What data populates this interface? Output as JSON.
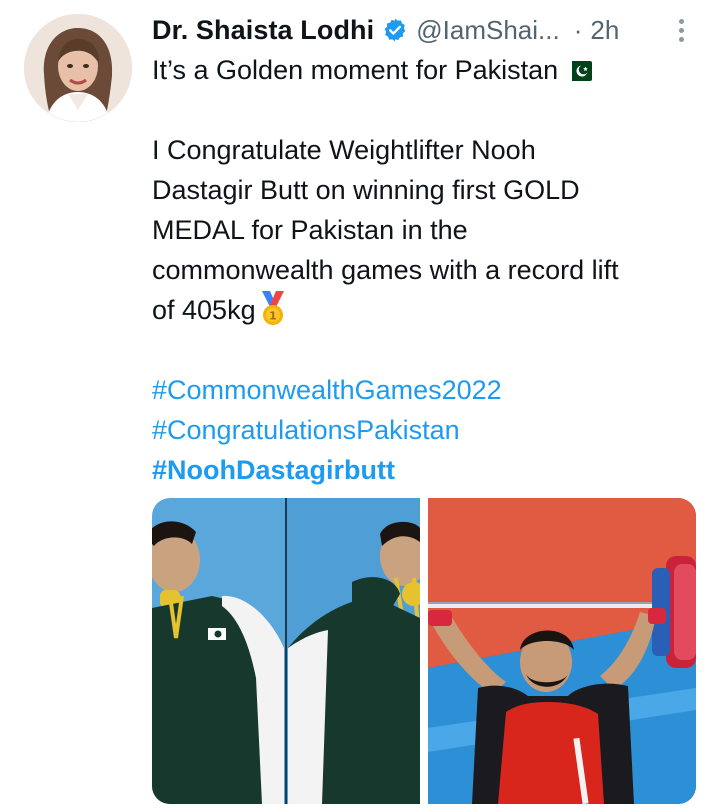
{
  "tweet": {
    "display_name": "Dr. Shaista Lodhi",
    "handle": "@IamShai...",
    "separator": "·",
    "time": "2h",
    "lines": [
      "It’s a Golden moment for Pakistan",
      "I Congratulate Weightlifter Nooh",
      "Dastagir Butt on winning first GOLD",
      "MEDAL for Pakistan in the",
      "commonwealth games with a record lift",
      "of 405kg"
    ],
    "hashtags": [
      "#CommonwealthGames2022",
      "#CongratulationsPakistan",
      "#NoohDastagirbutt"
    ],
    "icons": {
      "verified": "verified-badge-icon",
      "more": "more-options-icon",
      "flag": "pakistan-flag-emoji",
      "medal": "gold-medal-emoji"
    }
  },
  "colors": {
    "text": "#0f1419",
    "secondary": "#536471",
    "link": "#1d9bf0",
    "verified": "#1d9bf0"
  },
  "media": [
    {
      "kind": "photo",
      "description_icon": "athlete-biting-medal-photo"
    },
    {
      "kind": "photo",
      "description_icon": "weightlifter-lifting-photo"
    }
  ]
}
